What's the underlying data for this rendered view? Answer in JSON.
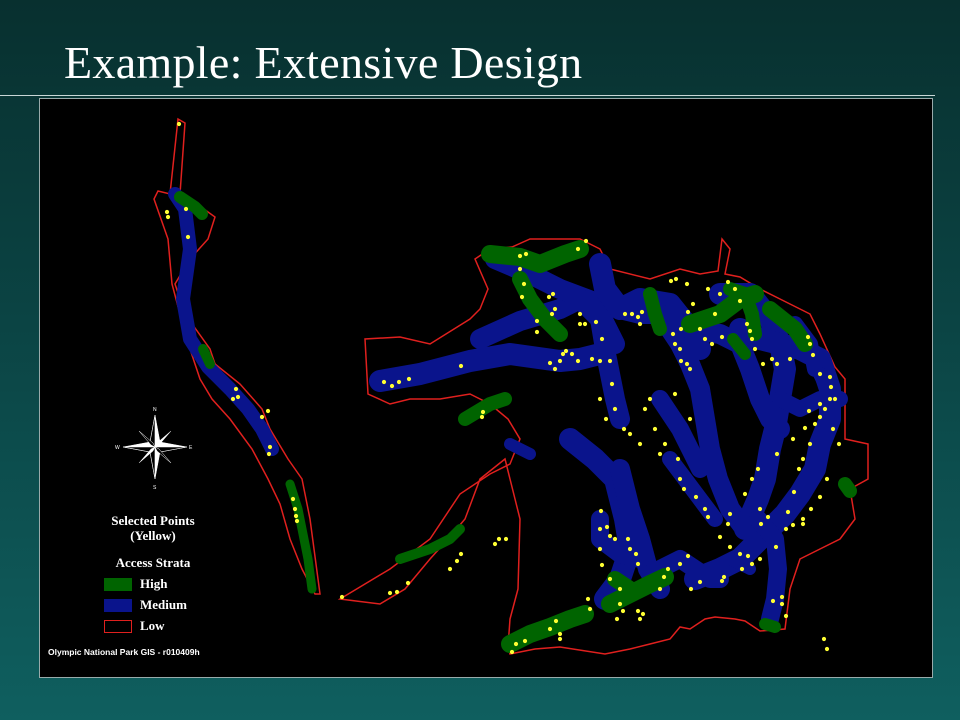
{
  "slide": {
    "title": "Example:  Extensive Design"
  },
  "map": {
    "background": "#000000",
    "boundary_color": "#e0201e",
    "credit": "Olympic National Park GIS - r010409h",
    "compass": {
      "n": "N",
      "s": "S",
      "e": "E",
      "w": "W"
    },
    "legend": {
      "title": "Selected Points (Yellow)",
      "title_line1": "Selected Points",
      "title_line2": "(Yellow)",
      "strata_heading": "Access Strata",
      "items": [
        {
          "label": "High",
          "color": "#006400"
        },
        {
          "label": "Medium",
          "color": "#0a148c"
        },
        {
          "label": "Low",
          "color": "#000000",
          "outline": "#e0201e"
        }
      ]
    },
    "colors": {
      "high": "#006400",
      "medium": "#0a148c",
      "points": "#ffff33"
    }
  }
}
